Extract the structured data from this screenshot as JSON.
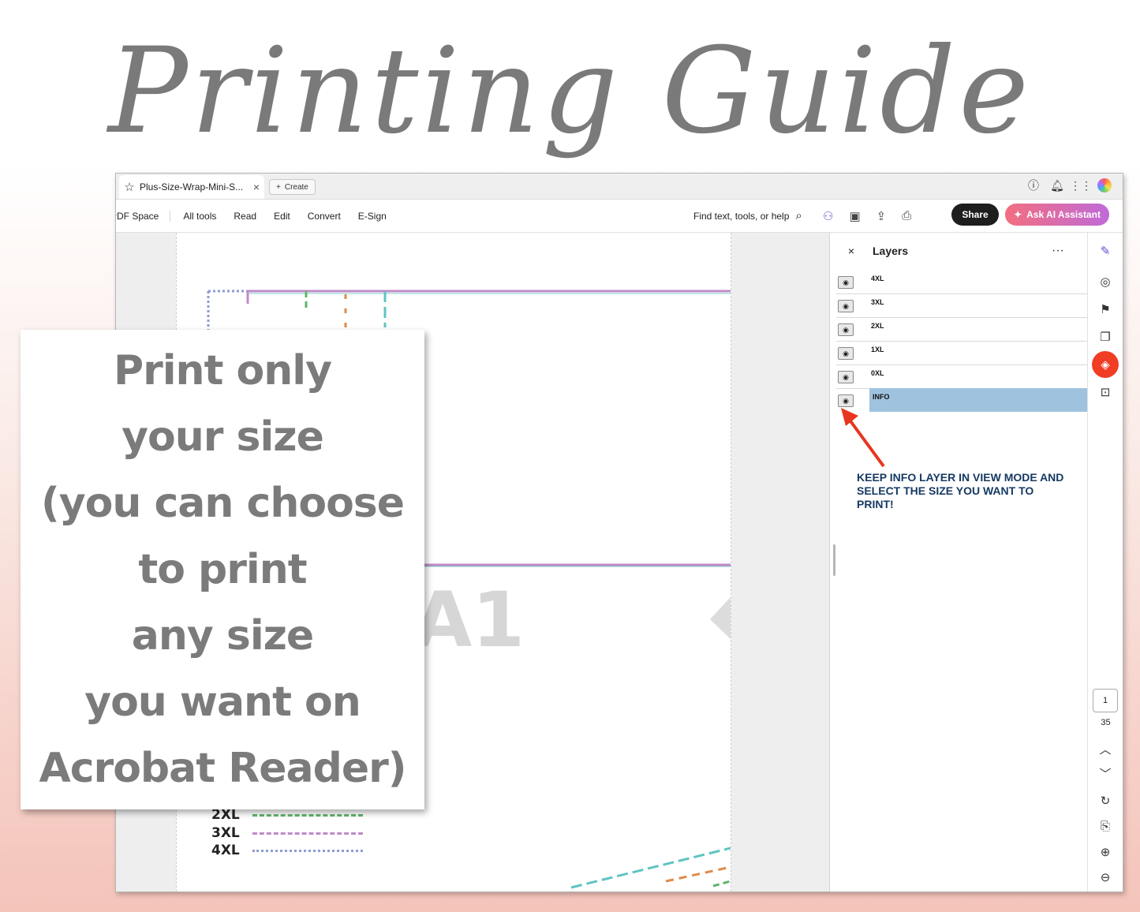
{
  "headline": "Printing Guide",
  "callout": "Print only\nyour size\n(you can choose\nto print\nany size\nyou want on\nAcrobat Reader)",
  "browser": {
    "tab_title": "Plus-Size-Wrap-Mini-S...",
    "tab_close": "×",
    "create_label": "Create",
    "create_icon": "+"
  },
  "toolbar": {
    "space_label": "PDF Space",
    "menu": [
      "All tools",
      "Read",
      "Edit",
      "Convert",
      "E-Sign"
    ],
    "find_label": "Find text, tools, or help",
    "share_label": "Share",
    "ai_label": "Ask AI Assistant"
  },
  "document": {
    "big_letter": "A1",
    "sizes": [
      {
        "label": "2XL",
        "color": "#5fb56a"
      },
      {
        "label": "3XL",
        "color": "#c08ac9"
      },
      {
        "label": "4XL",
        "color": "#8f9bd3"
      }
    ]
  },
  "layers_panel": {
    "title": "Layers",
    "close": "×",
    "more": "···",
    "layers": [
      {
        "name": "4XL",
        "selected": false
      },
      {
        "name": "3XL",
        "selected": false
      },
      {
        "name": "2XL",
        "selected": false
      },
      {
        "name": "1XL",
        "selected": false
      },
      {
        "name": "0XL",
        "selected": false
      },
      {
        "name": "INFO",
        "selected": true
      }
    ],
    "note": "KEEP INFO LAYER IN VIEW MODE AND SELECT THE SIZE YOU WANT TO PRINT!"
  },
  "page_nav": {
    "current": "1",
    "total": "35"
  },
  "colors": {
    "arrow": "#e8351e",
    "active_rail": "#f03d24",
    "note_text": "#163a63",
    "selected_layer": "#9fc3de"
  }
}
